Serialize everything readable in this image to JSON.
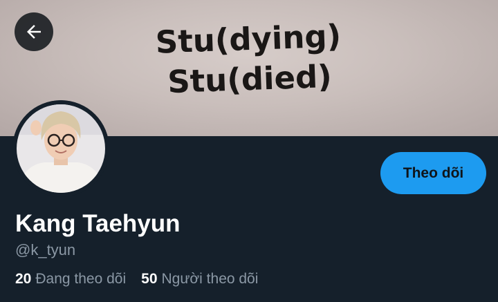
{
  "header": {
    "banner_line_1": "Stu(dying)",
    "banner_line_2": "Stu(died)",
    "back_icon": "arrow-left-icon"
  },
  "profile": {
    "display_name": "Kang Taehyun",
    "handle": "@k_tyun",
    "follow_label": "Theo dõi",
    "following_count": "20",
    "following_label": "Đang theo dõi",
    "followers_count": "50",
    "followers_label": "Người theo dõi"
  },
  "colors": {
    "background": "#15202b",
    "accent": "#1d9bf0",
    "secondary_text": "#8b98a5"
  }
}
